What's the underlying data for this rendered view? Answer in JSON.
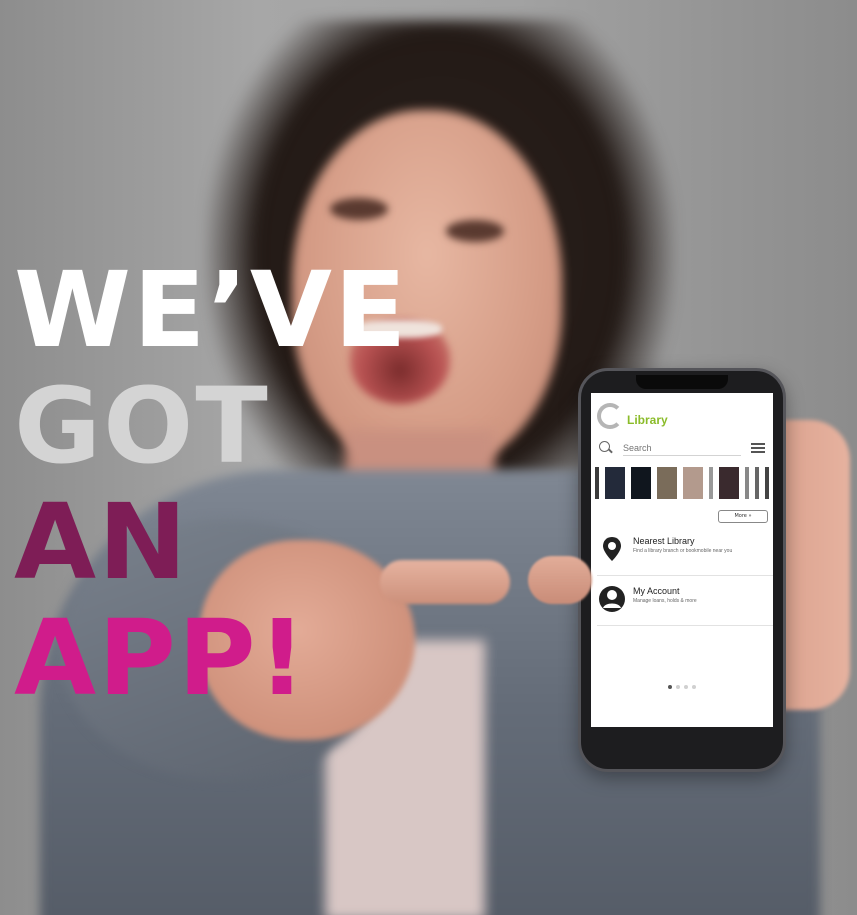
{
  "headline": {
    "line1": "WE’VE",
    "line2": "GOT",
    "line3": "AN",
    "line4": "APP!"
  },
  "colors": {
    "line1": "#ffffff",
    "line2": "#d4d4d4",
    "line3": "#7e1d56",
    "line4": "#d01c8b",
    "library_green": "#8bbc2a"
  },
  "phone": {
    "app": {
      "logo": {
        "icon": "library-logo-icon",
        "word": "Library"
      },
      "search": {
        "placeholder": "Search"
      },
      "book_carousel": {
        "book_count": 10
      },
      "more_button": "More »",
      "menu": [
        {
          "icon": "location-pin-icon",
          "title": "Nearest Library",
          "subtitle": "Find a library branch or bookmobile near you"
        },
        {
          "icon": "user-account-icon",
          "title": "My Account",
          "subtitle": "Manage loans, holds & more"
        }
      ],
      "pager": {
        "pages": 4,
        "active": 1
      }
    }
  }
}
